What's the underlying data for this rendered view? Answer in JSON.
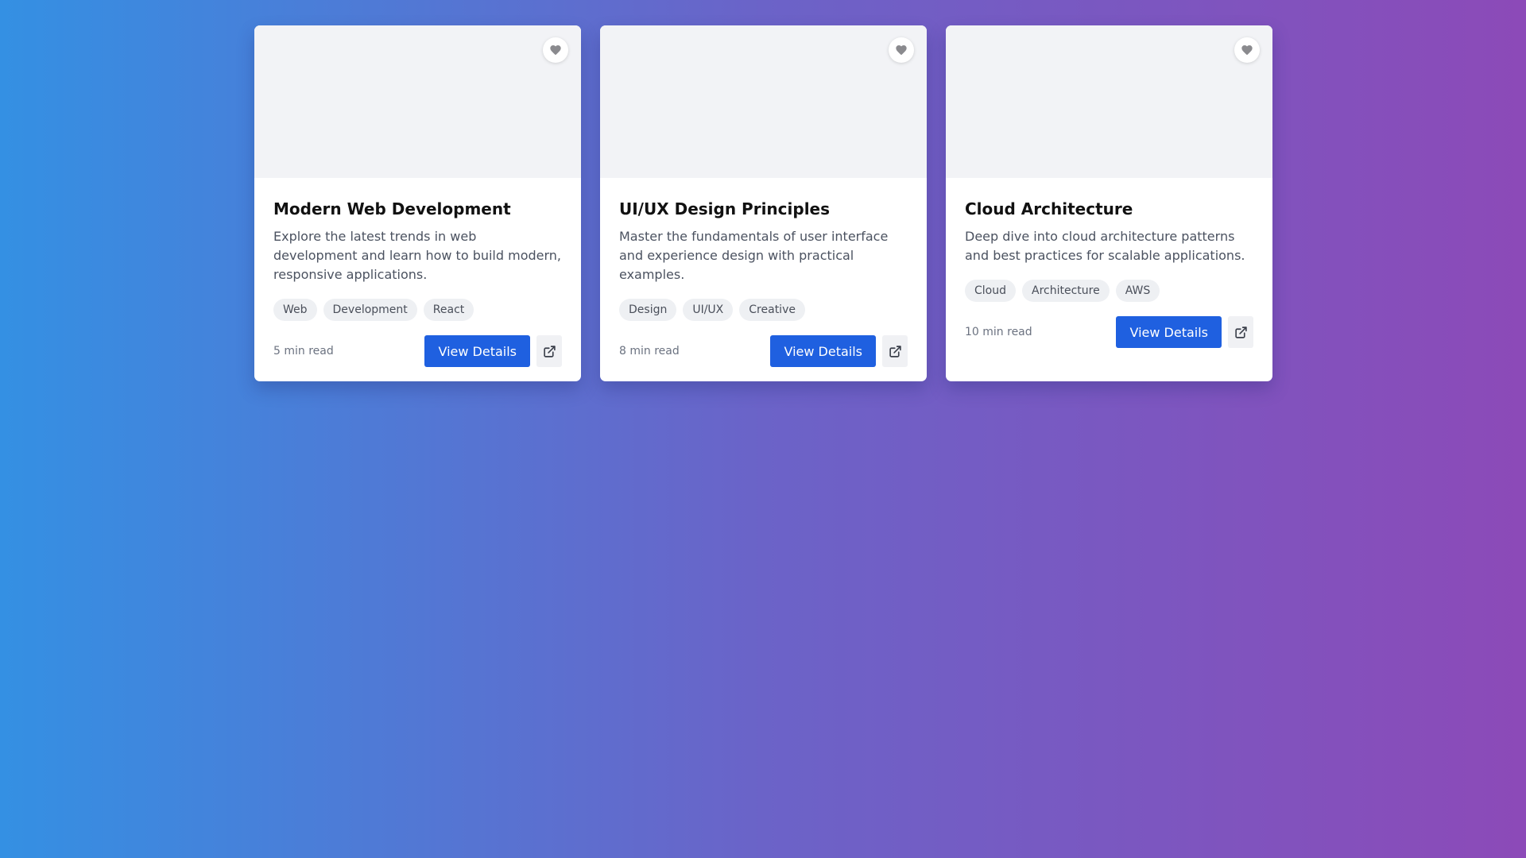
{
  "colors": {
    "accent": "#1f60e0",
    "card_image_bg": "#f2f3f6",
    "tag_bg": "#eef0f3"
  },
  "icons": {
    "favorite": "heart-icon",
    "open": "external-link-icon"
  },
  "cards": [
    {
      "title": "Modern Web Development",
      "description": "Explore the latest trends in web development and learn how to build modern, responsive applications.",
      "tags": [
        "Web",
        "Development",
        "React"
      ],
      "read_time": "5 min read",
      "button_label": "View Details"
    },
    {
      "title": "UI/UX Design Principles",
      "description": "Master the fundamentals of user interface and experience design with practical examples.",
      "tags": [
        "Design",
        "UI/UX",
        "Creative"
      ],
      "read_time": "8 min read",
      "button_label": "View Details"
    },
    {
      "title": "Cloud Architecture",
      "description": "Deep dive into cloud architecture patterns and best practices for scalable applications.",
      "tags": [
        "Cloud",
        "Architecture",
        "AWS"
      ],
      "read_time": "10 min read",
      "button_label": "View Details"
    }
  ]
}
